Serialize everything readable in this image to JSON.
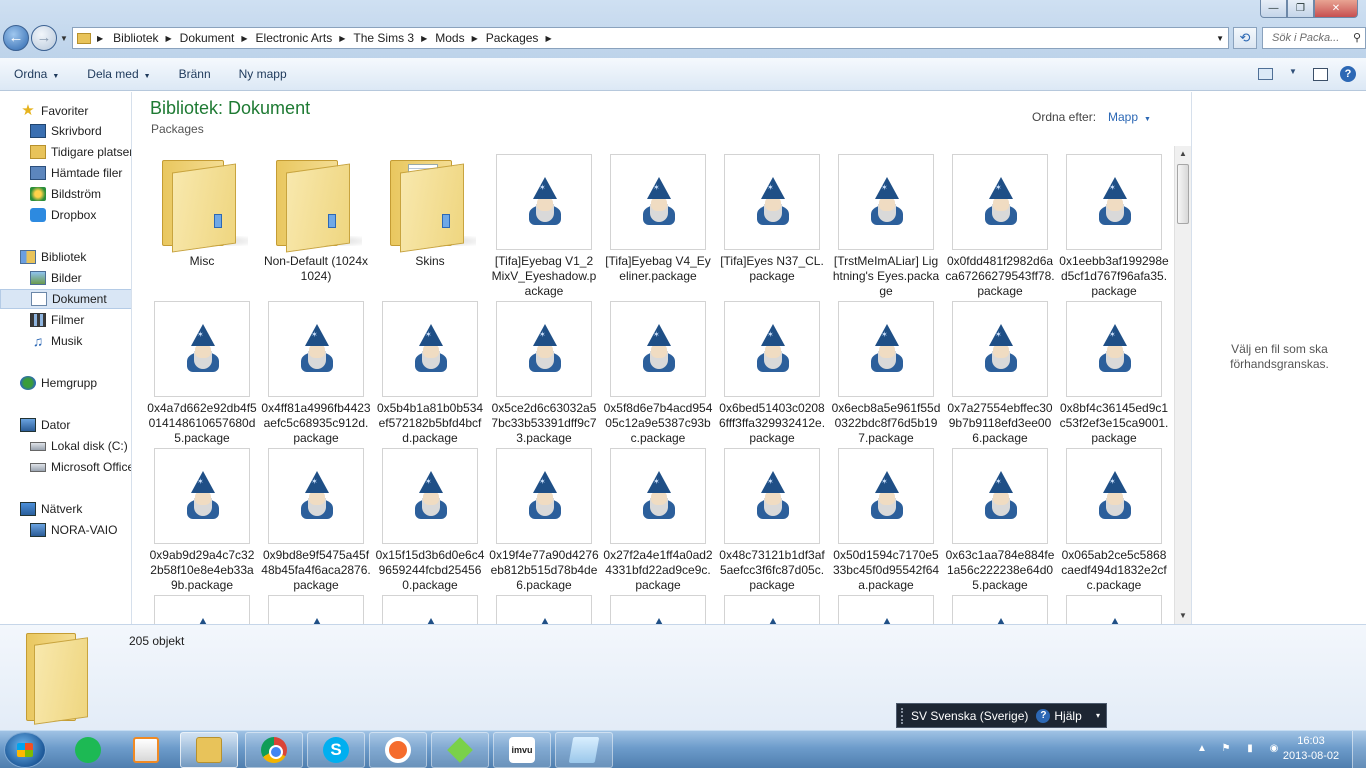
{
  "window": {
    "controls": {
      "minimize": "—",
      "maximize": "❐",
      "close": "✕"
    }
  },
  "address": {
    "breadcrumbs": [
      "Bibliotek",
      "Dokument",
      "Electronic Arts",
      "The Sims 3",
      "Mods",
      "Packages"
    ],
    "search_placeholder": "Sök i Packa..."
  },
  "toolbar": {
    "organize": "Ordna",
    "share": "Dela med",
    "burn": "Bränn",
    "new_folder": "Ny mapp"
  },
  "nav": {
    "favorites": {
      "label": "Favoriter",
      "items": [
        "Skrivbord",
        "Tidigare platser",
        "Hämtade filer",
        "Bildström",
        "Dropbox"
      ]
    },
    "libraries": {
      "label": "Bibliotek",
      "items": [
        "Bilder",
        "Dokument",
        "Filmer",
        "Musik"
      ],
      "selected": "Dokument"
    },
    "homegroup": {
      "label": "Hemgrupp"
    },
    "computer": {
      "label": "Dator",
      "items": [
        "Lokal disk (C:)",
        "Microsoft Office"
      ]
    },
    "network": {
      "label": "Nätverk",
      "items": [
        "NORA-VAIO"
      ]
    }
  },
  "content": {
    "title": "Bibliotek: Dokument",
    "subtitle": "Packages",
    "arrange_label": "Ordna efter:",
    "arrange_value": "Mapp",
    "items": [
      {
        "name": "Misc",
        "type": "folder"
      },
      {
        "name": "Non-Default (1024x1024)",
        "type": "folder"
      },
      {
        "name": "Skins",
        "type": "folder-docs"
      },
      {
        "name": "[Tifa]Eyebag V1_2 MixV_Eyeshadow.package",
        "type": "package"
      },
      {
        "name": "[Tifa]Eyebag V4_Eyeliner.package",
        "type": "package"
      },
      {
        "name": "[Tifa]Eyes N37_CL.package",
        "type": "package"
      },
      {
        "name": "[TrstMeImALiar] Lightning's Eyes.package",
        "type": "package"
      },
      {
        "name": "0x0fdd481f2982d6aca67266279543ff78.package",
        "type": "package"
      },
      {
        "name": "0x1eebb3af199298ed5cf1d767f96afa35.package",
        "type": "package"
      },
      {
        "name": "0x4a7d662e92db4f5014148610657680d5.package",
        "type": "package"
      },
      {
        "name": "0x4ff81a4996fb4423aefc5c68935c912d.package",
        "type": "package"
      },
      {
        "name": "0x5b4b1a81b0b534ef572182b5bfd4bcfd.package",
        "type": "package"
      },
      {
        "name": "0x5ce2d6c63032a57bc33b53391dff9c73.package",
        "type": "package"
      },
      {
        "name": "0x5f8d6e7b4acd95405c12a9e5387c93bc.package",
        "type": "package"
      },
      {
        "name": "0x6bed51403c02086fff3ffa329932412e.package",
        "type": "package"
      },
      {
        "name": "0x6ecb8a5e961f55d0322bdc8f76d5b197.package",
        "type": "package"
      },
      {
        "name": "0x7a27554ebffec309b7b9118efd3ee006.package",
        "type": "package"
      },
      {
        "name": "0x8bf4c36145ed9c1c53f2ef3e15ca9001.package",
        "type": "package"
      },
      {
        "name": "0x9ab9d29a4c7c322b58f10e8e4eb33a9b.package",
        "type": "package"
      },
      {
        "name": "0x9bd8e9f5475a45f48b45fa4f6aca2876.package",
        "type": "package"
      },
      {
        "name": "0x15f15d3b6d0e6c49659244fcbd254560.package",
        "type": "package"
      },
      {
        "name": "0x19f4e77a90d4276eb812b515d78b4de6.package",
        "type": "package"
      },
      {
        "name": "0x27f2a4e1ff4a0ad24331bfd22ad9ce9c.package",
        "type": "package"
      },
      {
        "name": "0x48c73121b1df3af5aefcc3f6fc87d05c.package",
        "type": "package"
      },
      {
        "name": "0x50d1594c7170e533bc45f0d95542f64a.package",
        "type": "package"
      },
      {
        "name": "0x63c1aa784e884fe1a56c222238e64d05.package",
        "type": "package"
      },
      {
        "name": "0x065ab2ce5c5868caedf494d1832e2cfc.package",
        "type": "package"
      },
      {
        "name": "",
        "type": "package"
      },
      {
        "name": "",
        "type": "package"
      },
      {
        "name": "",
        "type": "package"
      },
      {
        "name": "",
        "type": "package"
      },
      {
        "name": "",
        "type": "package"
      },
      {
        "name": "",
        "type": "package"
      },
      {
        "name": "",
        "type": "package"
      },
      {
        "name": "",
        "type": "package"
      },
      {
        "name": "",
        "type": "package"
      }
    ]
  },
  "preview": {
    "text": "Välj en fil som ska förhandsgranskas."
  },
  "details": {
    "count": "205 objekt"
  },
  "langbar": {
    "language": "SV Svenska (Sverige)",
    "help": "Hjälp"
  },
  "taskbar": {
    "apps": [
      "spotify-icon",
      "media-center-icon",
      "explorer-icon",
      "chrome-icon",
      "skype-icon",
      "origin-icon",
      "sims3-icon",
      "imvu-icon",
      "notepad-icon"
    ],
    "clock_time": "16:03",
    "clock_date": "2013-08-02"
  }
}
